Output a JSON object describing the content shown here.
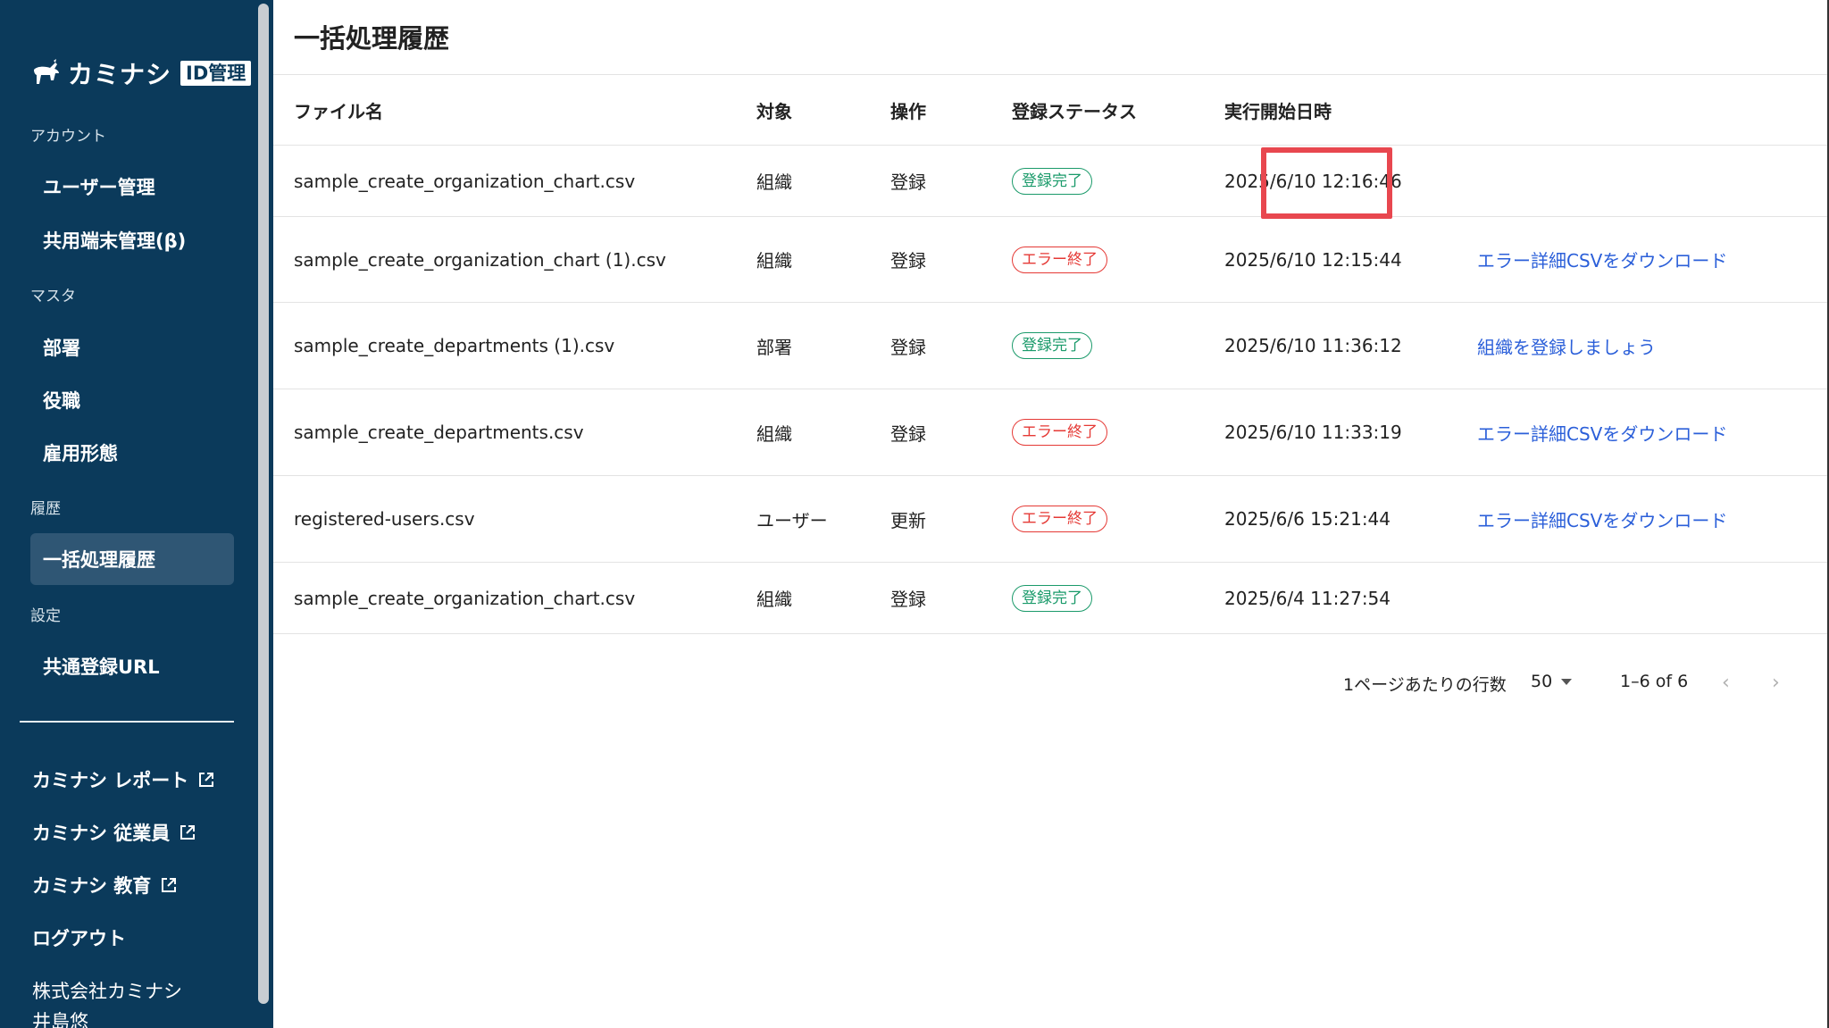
{
  "logo": {
    "text": "カミナシ",
    "badge": "ID管理"
  },
  "sidebar": {
    "sections": [
      {
        "label": "アカウント",
        "items": [
          "ユーザー管理",
          "共用端末管理(β)"
        ]
      },
      {
        "label": "マスタ",
        "items": [
          "部署",
          "役職",
          "雇用形態"
        ]
      },
      {
        "label": "履歴",
        "items": [
          "一括処理履歴"
        ]
      },
      {
        "label": "設定",
        "items": [
          "共通登録URL"
        ]
      }
    ],
    "external_links": [
      "カミナシ レポート",
      "カミナシ 従業員",
      "カミナシ 教育"
    ],
    "logout": "ログアウト",
    "company": "株式会社カミナシ",
    "user": "井島悠"
  },
  "page": {
    "title": "一括処理履歴"
  },
  "table": {
    "headers": {
      "file": "ファイル名",
      "target": "対象",
      "op": "操作",
      "status": "登録ステータス",
      "date": "実行開始日時"
    },
    "rows": [
      {
        "file": "sample_create_organization_chart.csv",
        "target": "組織",
        "op": "登録",
        "status": "登録完了",
        "status_type": "ok",
        "date": "2025/6/10 12:16:46",
        "action": ""
      },
      {
        "file": "sample_create_organization_chart (1).csv",
        "target": "組織",
        "op": "登録",
        "status": "エラー終了",
        "status_type": "err",
        "date": "2025/6/10 12:15:44",
        "action": "エラー詳細CSVをダウンロード"
      },
      {
        "file": "sample_create_departments (1).csv",
        "target": "部署",
        "op": "登録",
        "status": "登録完了",
        "status_type": "ok",
        "date": "2025/6/10 11:36:12",
        "action": "組織を登録しましょう"
      },
      {
        "file": "sample_create_departments.csv",
        "target": "組織",
        "op": "登録",
        "status": "エラー終了",
        "status_type": "err",
        "date": "2025/6/10 11:33:19",
        "action": "エラー詳細CSVをダウンロード"
      },
      {
        "file": "registered-users.csv",
        "target": "ユーザー",
        "op": "更新",
        "status": "エラー終了",
        "status_type": "err",
        "date": "2025/6/6 15:21:44",
        "action": "エラー詳細CSVをダウンロード"
      },
      {
        "file": "sample_create_organization_chart.csv",
        "target": "組織",
        "op": "登録",
        "status": "登録完了",
        "status_type": "ok",
        "date": "2025/6/4 11:27:54",
        "action": ""
      }
    ]
  },
  "pagination": {
    "rows_per_page_label": "1ページあたりの行数",
    "rows_per_page": "50",
    "range": "1–6 of 6"
  },
  "colors": {
    "sidebar_bg": "#0b3a5b",
    "status_ok": "#1a9a6a",
    "status_err": "#e53935",
    "link": "#2b5fd9",
    "highlight": "#e8474f"
  }
}
